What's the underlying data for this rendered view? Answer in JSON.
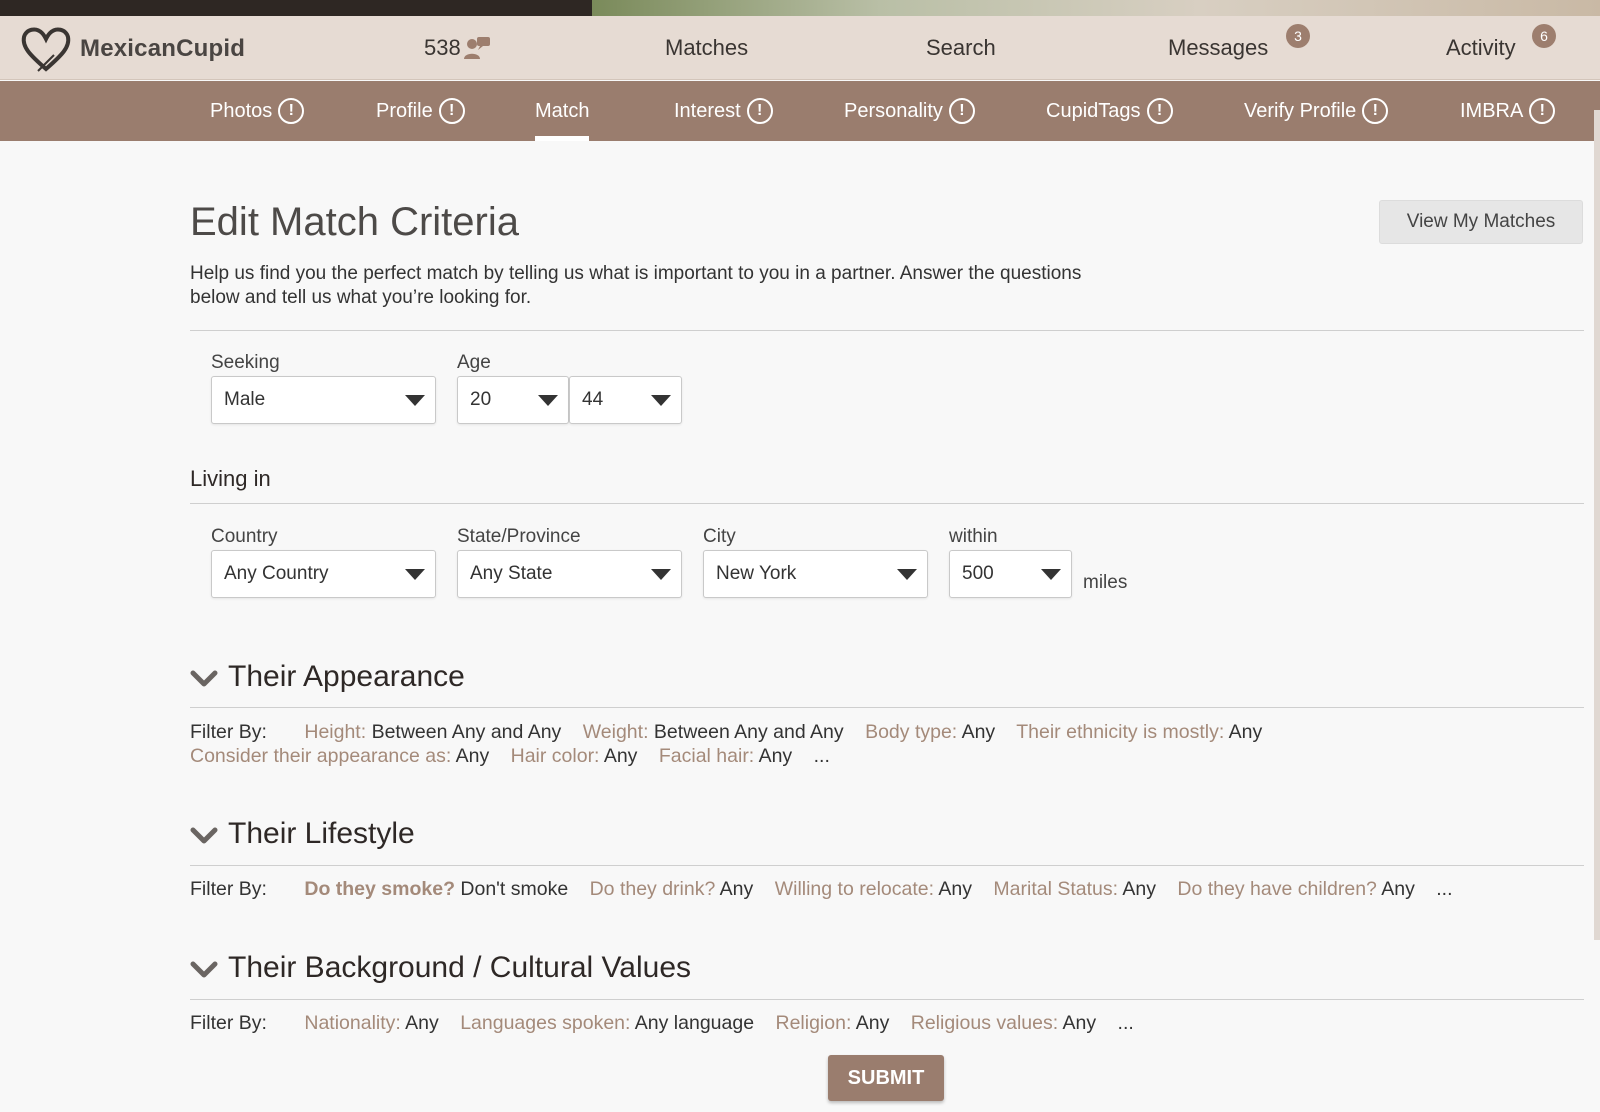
{
  "brand": {
    "name": "MexicanCupid"
  },
  "header": {
    "count": "538",
    "nav": [
      {
        "label": "Matches"
      },
      {
        "label": "Search"
      },
      {
        "label": "Messages",
        "badge": "3"
      },
      {
        "label": "Activity",
        "badge": "6"
      }
    ]
  },
  "subnav": {
    "items": [
      {
        "label": "Photos",
        "alert": "!"
      },
      {
        "label": "Profile",
        "alert": "!"
      },
      {
        "label": "Match"
      },
      {
        "label": "Interest",
        "alert": "!"
      },
      {
        "label": "Personality",
        "alert": "!"
      },
      {
        "label": "CupidTags",
        "alert": "!"
      },
      {
        "label": "Verify Profile",
        "alert": "!"
      },
      {
        "label": "IMBRA",
        "alert": "!"
      }
    ]
  },
  "page": {
    "title": "Edit Match Criteria",
    "desc_line1": "Help us find you the perfect match by telling us what is important to you in a partner. Answer the questions",
    "desc_line2": "below and tell us what you’re looking for.",
    "view_matches": "View My Matches"
  },
  "criteria": {
    "seeking_label": "Seeking",
    "seeking_value": "Male",
    "age_label": "Age",
    "age_min": "20",
    "age_max": "44",
    "living_in": "Living in",
    "country_label": "Country",
    "country_value": "Any Country",
    "state_label": "State/Province",
    "state_value": "Any State",
    "city_label": "City",
    "city_value": "New York",
    "within_label": "within",
    "within_value": "500",
    "miles": "miles"
  },
  "sections": {
    "filter_by": "Filter By:",
    "ellipsis": "...",
    "appearance": {
      "title": "Their Appearance",
      "height_k": "Height:",
      "height_v": "Between Any and Any",
      "weight_k": "Weight:",
      "weight_v": "Between Any and Any",
      "body_k": "Body type:",
      "body_v": "Any",
      "ethnicity_k": "Their ethnicity is mostly:",
      "ethnicity_v": "Any",
      "consider_k": "Consider their appearance as:",
      "consider_v": "Any",
      "hair_k": "Hair color:",
      "hair_v": "Any",
      "facial_k": "Facial hair:",
      "facial_v": "Any"
    },
    "lifestyle": {
      "title": "Their Lifestyle",
      "smoke_k": "Do they smoke?",
      "smoke_v": "Don't smoke",
      "drink_k": "Do they drink?",
      "drink_v": "Any",
      "relocate_k": "Willing to relocate:",
      "relocate_v": "Any",
      "marital_k": "Marital Status:",
      "marital_v": "Any",
      "children_k": "Do they have children?",
      "children_v": "Any"
    },
    "background": {
      "title": "Their Background / Cultural Values",
      "nationality_k": "Nationality:",
      "nationality_v": "Any",
      "languages_k": "Languages spoken:",
      "languages_v": "Any language",
      "religion_k": "Religion:",
      "religion_v": "Any",
      "values_k": "Religious values:",
      "values_v": "Any"
    }
  },
  "submit": "SUBMIT",
  "colors": {
    "brand_brown": "#9a7d6e",
    "header_bg": "#e6dbd3",
    "key_text": "#a48a7a"
  }
}
